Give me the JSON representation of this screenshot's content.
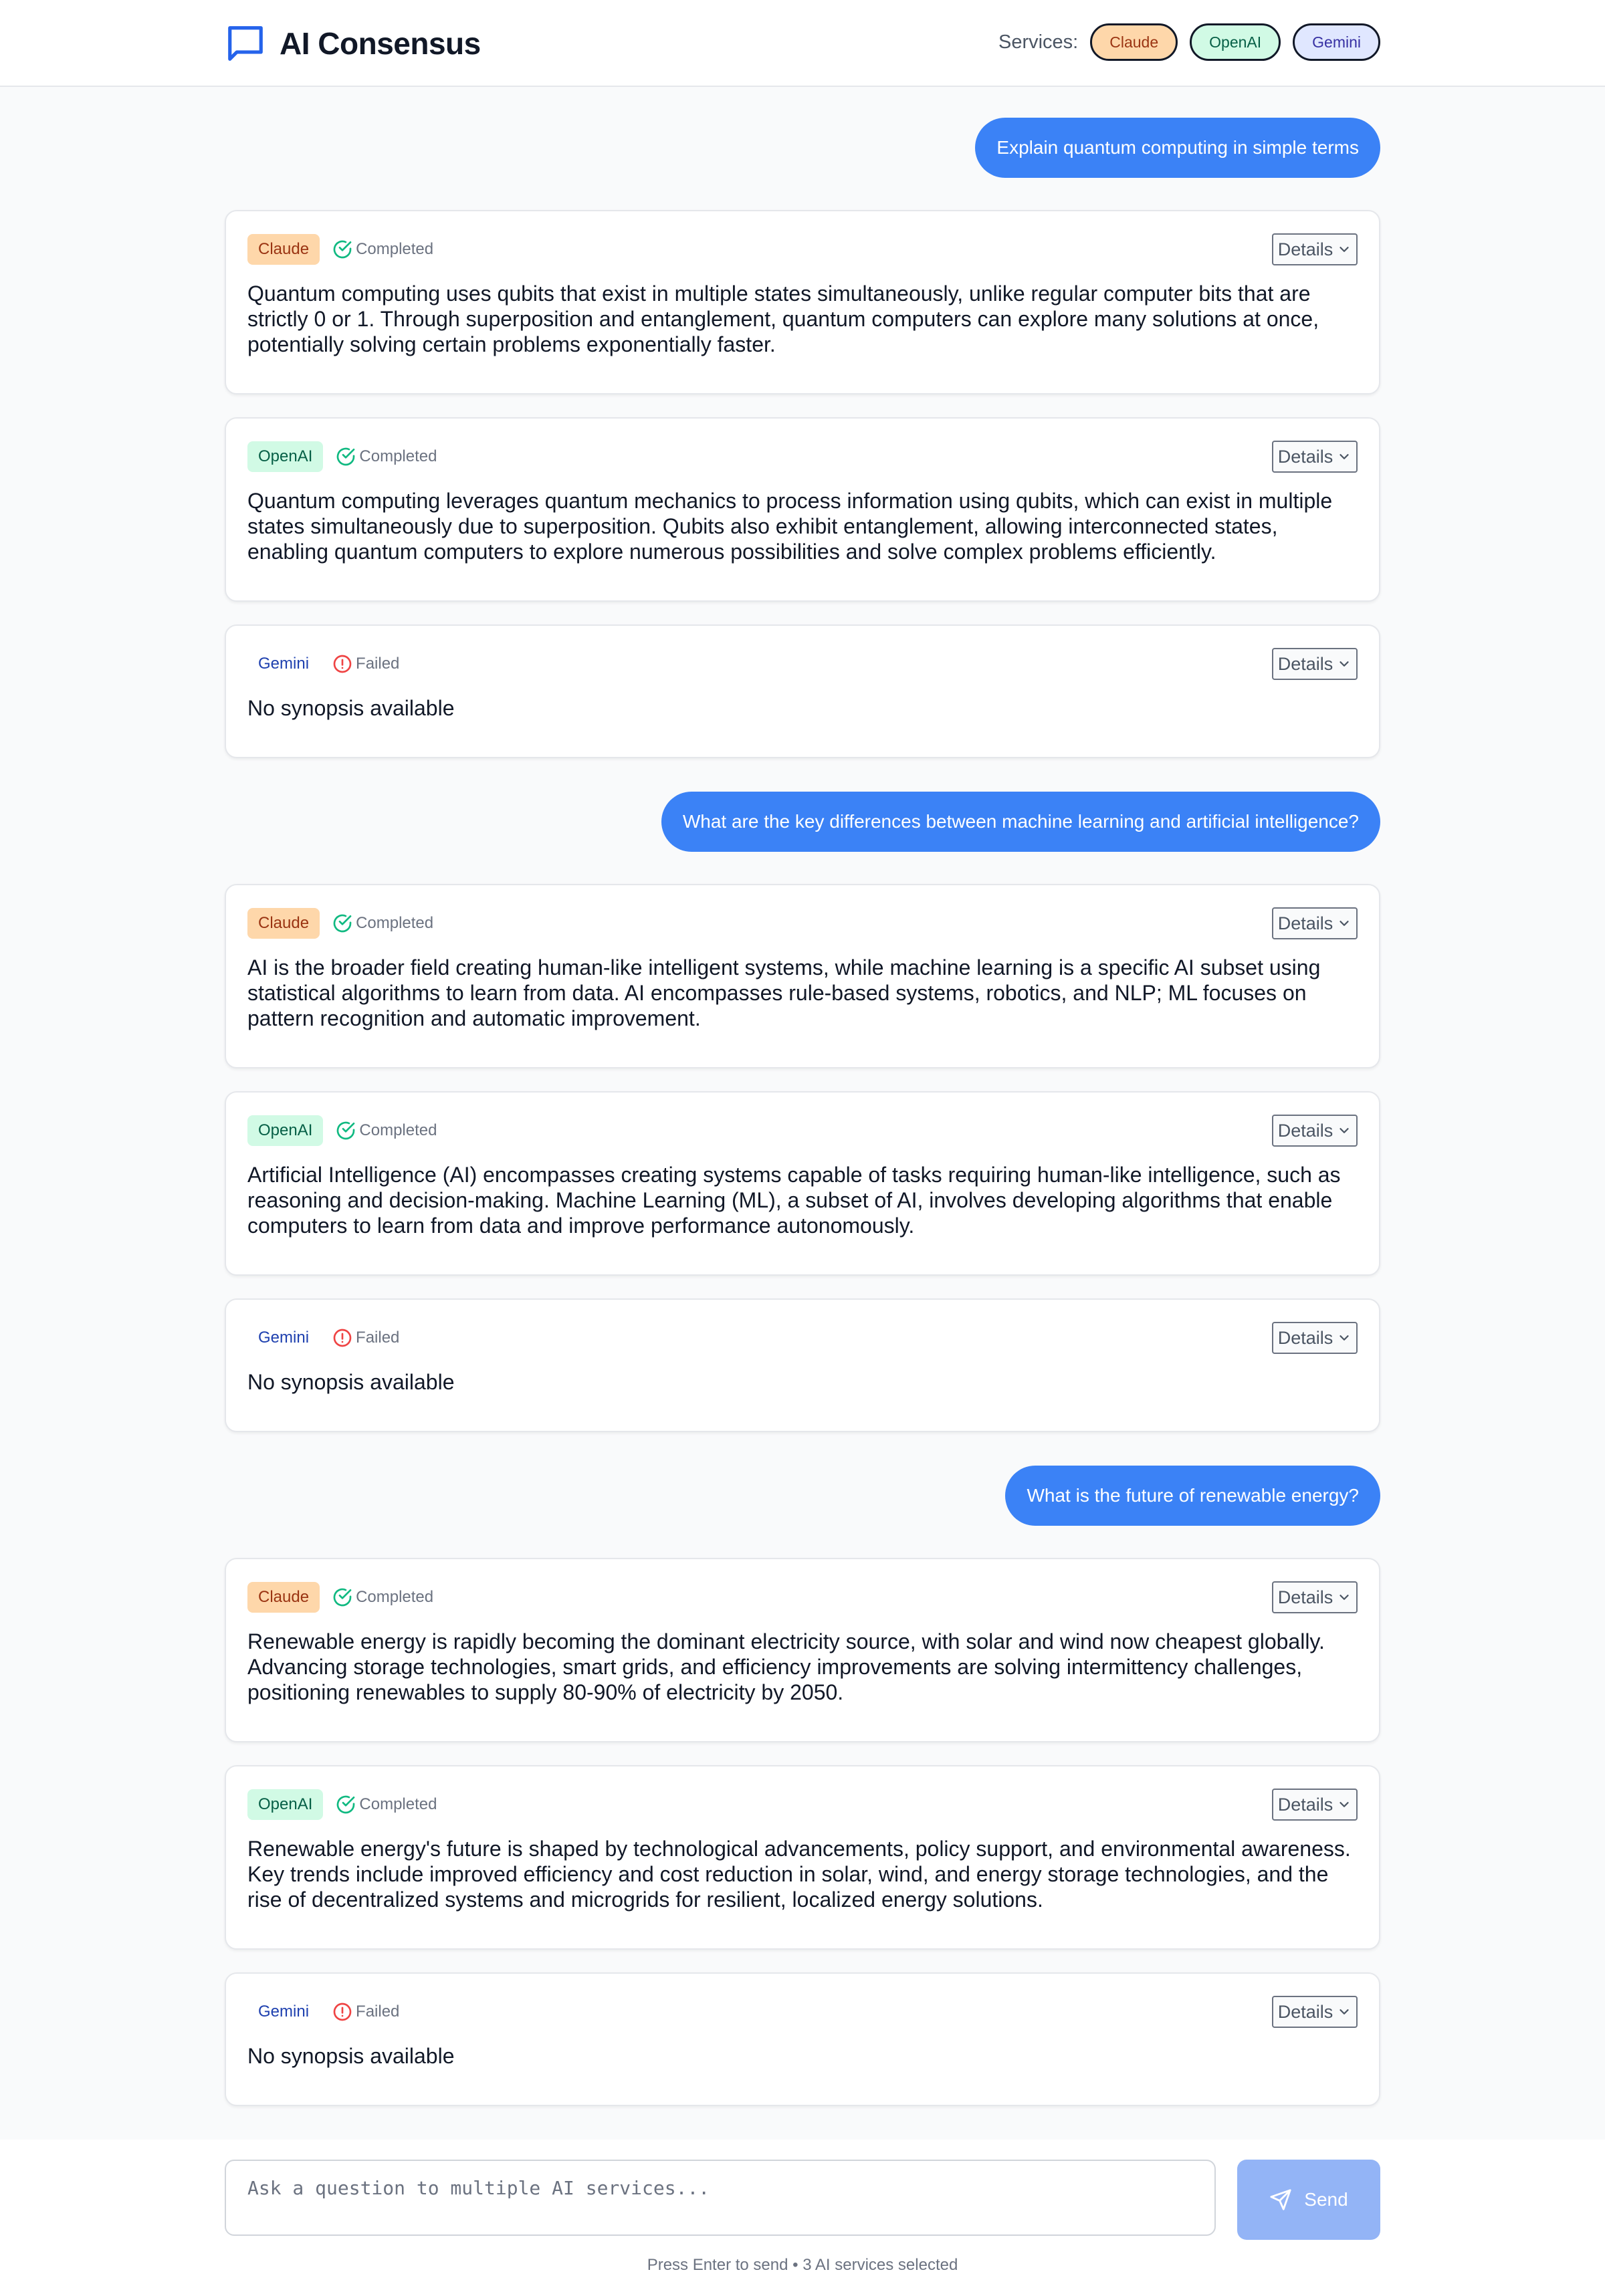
{
  "app": {
    "title": "AI Consensus"
  },
  "services_bar": {
    "label": "Services:",
    "toggles": [
      {
        "name": "Claude",
        "selected": true
      },
      {
        "name": "OpenAI",
        "selected": true
      },
      {
        "name": "Gemini",
        "selected": true
      }
    ]
  },
  "conversation": [
    {
      "question": "Explain quantum computing in simple terms",
      "responses": [
        {
          "service": "Claude",
          "status": "Completed",
          "details_label": "Details",
          "text": "Quantum computing uses qubits that exist in multiple states simultaneously, unlike regular computer bits that are strictly 0 or 1. Through superposition and entanglement, quantum computers can explore many solutions at once, potentially solving certain problems exponentially faster."
        },
        {
          "service": "OpenAI",
          "status": "Completed",
          "details_label": "Details",
          "text": "Quantum computing leverages quantum mechanics to process information using qubits, which can exist in multiple states simultaneously due to superposition. Qubits also exhibit entanglement, allowing interconnected states, enabling quantum computers to explore numerous possibilities and solve complex problems efficiently."
        },
        {
          "service": "Gemini",
          "status": "Failed",
          "details_label": "Details",
          "text": "No synopsis available"
        }
      ]
    },
    {
      "question": "What are the key differences between machine learning and artificial intelligence?",
      "responses": [
        {
          "service": "Claude",
          "status": "Completed",
          "details_label": "Details",
          "text": "AI is the broader field creating human-like intelligent systems, while machine learning is a specific AI subset using statistical algorithms to learn from data. AI encompasses rule-based systems, robotics, and NLP; ML focuses on pattern recognition and automatic improvement."
        },
        {
          "service": "OpenAI",
          "status": "Completed",
          "details_label": "Details",
          "text": "Artificial Intelligence (AI) encompasses creating systems capable of tasks requiring human-like intelligence, such as reasoning and decision-making. Machine Learning (ML), a subset of AI, involves developing algorithms that enable computers to learn from data and improve performance autonomously."
        },
        {
          "service": "Gemini",
          "status": "Failed",
          "details_label": "Details",
          "text": "No synopsis available"
        }
      ]
    },
    {
      "question": "What is the future of renewable energy?",
      "responses": [
        {
          "service": "Claude",
          "status": "Completed",
          "details_label": "Details",
          "text": "Renewable energy is rapidly becoming the dominant electricity source, with solar and wind now cheapest globally. Advancing storage technologies, smart grids, and efficiency improvements are solving intermittency challenges, positioning renewables to supply 80-90% of electricity by 2050."
        },
        {
          "service": "OpenAI",
          "status": "Completed",
          "details_label": "Details",
          "text": "Renewable energy's future is shaped by technological advancements, policy support, and environmental awareness. Key trends include improved efficiency and cost reduction in solar, wind, and energy storage technologies, and the rise of decentralized systems and microgrids for resilient, localized energy solutions."
        },
        {
          "service": "Gemini",
          "status": "Failed",
          "details_label": "Details",
          "text": "No synopsis available"
        }
      ]
    }
  ],
  "input": {
    "placeholder": "Ask a question to multiple AI services...",
    "value": "",
    "send_label": "Send",
    "hint": "Press Enter to send • 3 AI services selected"
  },
  "colors": {
    "accent": "#3b82f6",
    "send_disabled": "#93b4f6",
    "completed": "#10b981",
    "failed": "#ef4444",
    "claude_bg": "#fed7aa",
    "openai_bg": "#d1fae5",
    "gemini_bg": "#e0e7ff"
  },
  "icons": {
    "brand": "chat-bubble-icon",
    "completed": "check-circle-icon",
    "failed": "alert-circle-icon",
    "details": "chevron-down-icon",
    "send": "send-icon"
  }
}
